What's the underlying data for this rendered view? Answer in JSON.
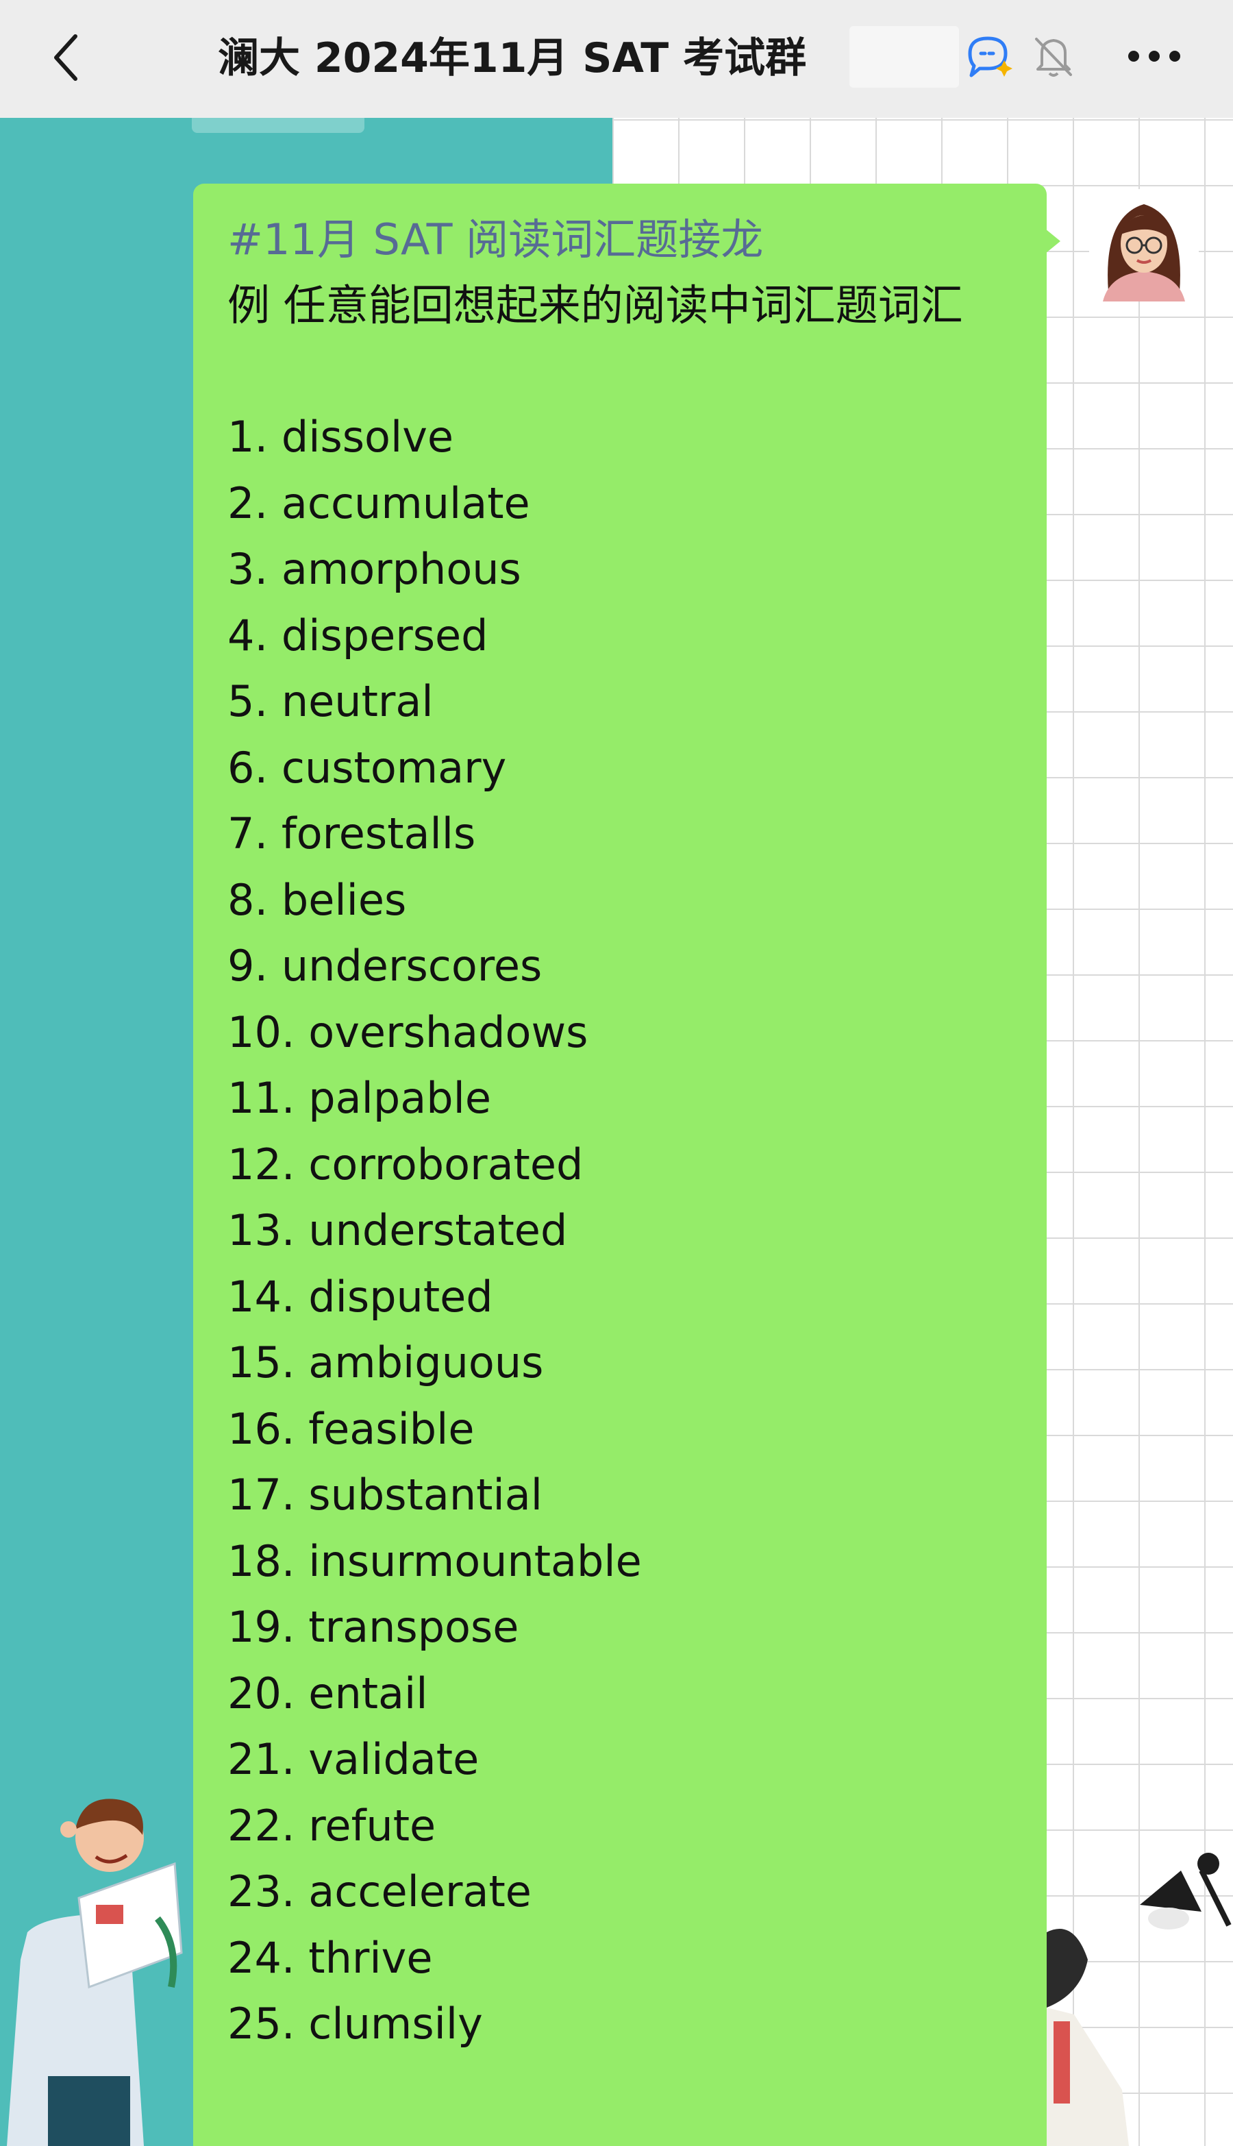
{
  "header": {
    "back_icon": "chevron-left-icon",
    "title": "澜大 2024年11月 SAT 考试群",
    "voice_icon": "chat-bubble-sparkle-icon",
    "mute_icon": "bell-muted-icon",
    "more_icon": "more-horizontal-icon"
  },
  "message": {
    "hashtag": "#11月 SAT 阅读词汇题接龙",
    "intro": "例 任意能回想起来的阅读中词汇题词汇",
    "items": [
      "1. dissolve",
      "2. accumulate",
      "3. amorphous",
      "4. dispersed",
      "5. neutral",
      "6. customary",
      "7. forestalls",
      "8. belies",
      "9. underscores",
      "10. overshadows",
      "11. palpable",
      "12. corroborated",
      "13. understated",
      "14. disputed",
      "15. ambiguous",
      "16. feasible",
      "17. substantial",
      "18. insurmountable",
      "19. transpose",
      "20. entail",
      "21. validate",
      "22. refute",
      "23. accelerate",
      "24. thrive",
      "25. clumsily"
    ]
  },
  "colors": {
    "bubble": "#95ec69",
    "hashtag": "#576b95",
    "header_bg": "#ededed",
    "teal_panel": "#4fbdb9"
  }
}
